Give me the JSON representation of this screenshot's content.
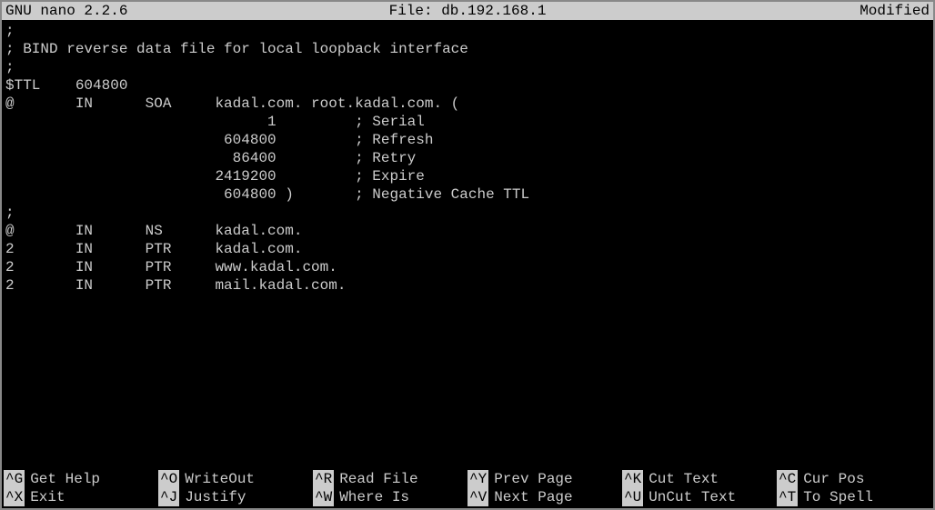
{
  "header": {
    "app": "  GNU nano 2.2.6",
    "file_label": "File: db.192.168.1",
    "status": "Modified "
  },
  "content": ";\n; BIND reverse data file for local loopback interface\n;\n$TTL    604800\n@       IN      SOA     kadal.com. root.kadal.com. (\n                              1         ; Serial\n                         604800         ; Refresh\n                          86400         ; Retry\n                        2419200         ; Expire\n                         604800 )       ; Negative Cache TTL\n;\n@       IN      NS      kadal.com.\n2       IN      PTR     kadal.com.\n2       IN      PTR     www.kadal.com.\n2       IN      PTR     mail.kadal.com.",
  "shortcuts": {
    "row1": [
      {
        "key": "^G",
        "label": "Get Help"
      },
      {
        "key": "^O",
        "label": "WriteOut"
      },
      {
        "key": "^R",
        "label": "Read File"
      },
      {
        "key": "^Y",
        "label": "Prev Page"
      },
      {
        "key": "^K",
        "label": "Cut Text"
      },
      {
        "key": "^C",
        "label": "Cur Pos"
      }
    ],
    "row2": [
      {
        "key": "^X",
        "label": "Exit"
      },
      {
        "key": "^J",
        "label": "Justify"
      },
      {
        "key": "^W",
        "label": "Where Is"
      },
      {
        "key": "^V",
        "label": "Next Page"
      },
      {
        "key": "^U",
        "label": "UnCut Text"
      },
      {
        "key": "^T",
        "label": "To Spell"
      }
    ]
  }
}
